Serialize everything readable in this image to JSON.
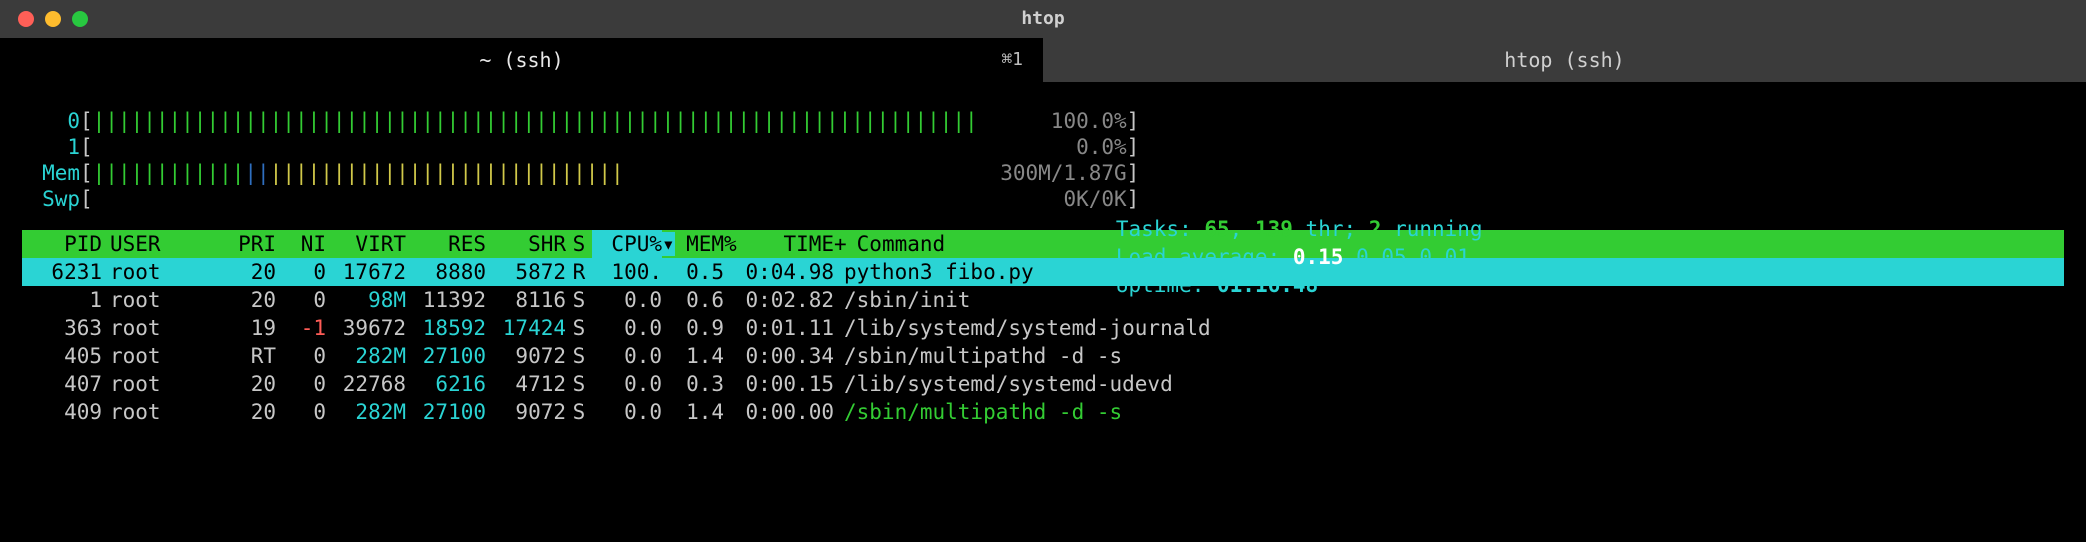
{
  "window": {
    "title": "htop"
  },
  "tabs": [
    {
      "label": "~ (ssh)",
      "shortcut": "⌘1",
      "active": true
    },
    {
      "label": "htop (ssh)",
      "shortcut": "",
      "active": false
    }
  ],
  "cpus": [
    {
      "id": "0",
      "percent": "100.0%",
      "fill_pct": 100,
      "color": "gr"
    },
    {
      "id": "1",
      "percent": "0.0%",
      "fill_pct": 0,
      "color": "gr"
    }
  ],
  "mem": {
    "label": "Mem",
    "value": "300M/1.87G",
    "segments": [
      {
        "color": "gr",
        "count": 12
      },
      {
        "color": "bl",
        "count": 2
      },
      {
        "color": "ye",
        "count": 28
      }
    ]
  },
  "swp": {
    "label": "Swp",
    "value": "0K/0K"
  },
  "stats": {
    "tasks_label": "Tasks: ",
    "tasks": "65",
    "threads": "139",
    "thr_suffix": " thr; ",
    "running": "2",
    "running_suffix": " running",
    "load_label": "Load average: ",
    "load1": "0.15",
    "load5": "0.05",
    "load15": "0.01",
    "uptime_label": "Uptime: ",
    "uptime": "01:16:48"
  },
  "columns": {
    "pid": "PID",
    "user": "USER",
    "pri": "PRI",
    "ni": "NI",
    "virt": "VIRT",
    "res": "RES",
    "shr": "SHR",
    "s": "S",
    "cpu": "CPU%",
    "mem": "MEM%",
    "time": "TIME+",
    "cmd": "Command",
    "sort_marker": "▽"
  },
  "processes": [
    {
      "pid": "6231",
      "user": "root",
      "pri": "20",
      "ni": "0",
      "virt": "17672",
      "res": "8880",
      "shr": "5872",
      "s": "R",
      "cpu": "100.",
      "mem": "0.5",
      "time": "0:04.98",
      "cmd": "python3 fibo.py",
      "selected": true
    },
    {
      "pid": "1",
      "user": "root",
      "pri": "20",
      "ni": "0",
      "virt": "98M",
      "res": "11392",
      "shr": "8116",
      "s": "S",
      "cpu": "0.0",
      "mem": "0.6",
      "time": "0:02.82",
      "cmd": "/sbin/init",
      "virt_cy": true
    },
    {
      "pid": "363",
      "user": "root",
      "pri": "19",
      "ni": "-1",
      "virt": "39672",
      "res": "18592",
      "shr": "17424",
      "s": "S",
      "cpu": "0.0",
      "mem": "0.9",
      "time": "0:01.11",
      "cmd": "/lib/systemd/systemd-journald",
      "ni_red": true,
      "res_cy": true,
      "shr_cy": true
    },
    {
      "pid": "405",
      "user": "root",
      "pri": "RT",
      "ni": "0",
      "virt": "282M",
      "res": "27100",
      "shr": "9072",
      "s": "S",
      "cpu": "0.0",
      "mem": "1.4",
      "time": "0:00.34",
      "cmd": "/sbin/multipathd -d -s",
      "virt_cy": true,
      "res_cy": true
    },
    {
      "pid": "407",
      "user": "root",
      "pri": "20",
      "ni": "0",
      "virt": "22768",
      "res": "6216",
      "shr": "4712",
      "s": "S",
      "cpu": "0.0",
      "mem": "0.3",
      "time": "0:00.15",
      "cmd": "/lib/systemd/systemd-udevd",
      "res_cy": true
    },
    {
      "pid": "409",
      "user": "root",
      "pri": "20",
      "ni": "0",
      "virt": "282M",
      "res": "27100",
      "shr": "9072",
      "s": "S",
      "cpu": "0.0",
      "mem": "1.4",
      "time": "0:00.00",
      "cmd": "/sbin/multipathd -d -s",
      "virt_cy": true,
      "res_cy": true,
      "cmd_green": true
    }
  ]
}
